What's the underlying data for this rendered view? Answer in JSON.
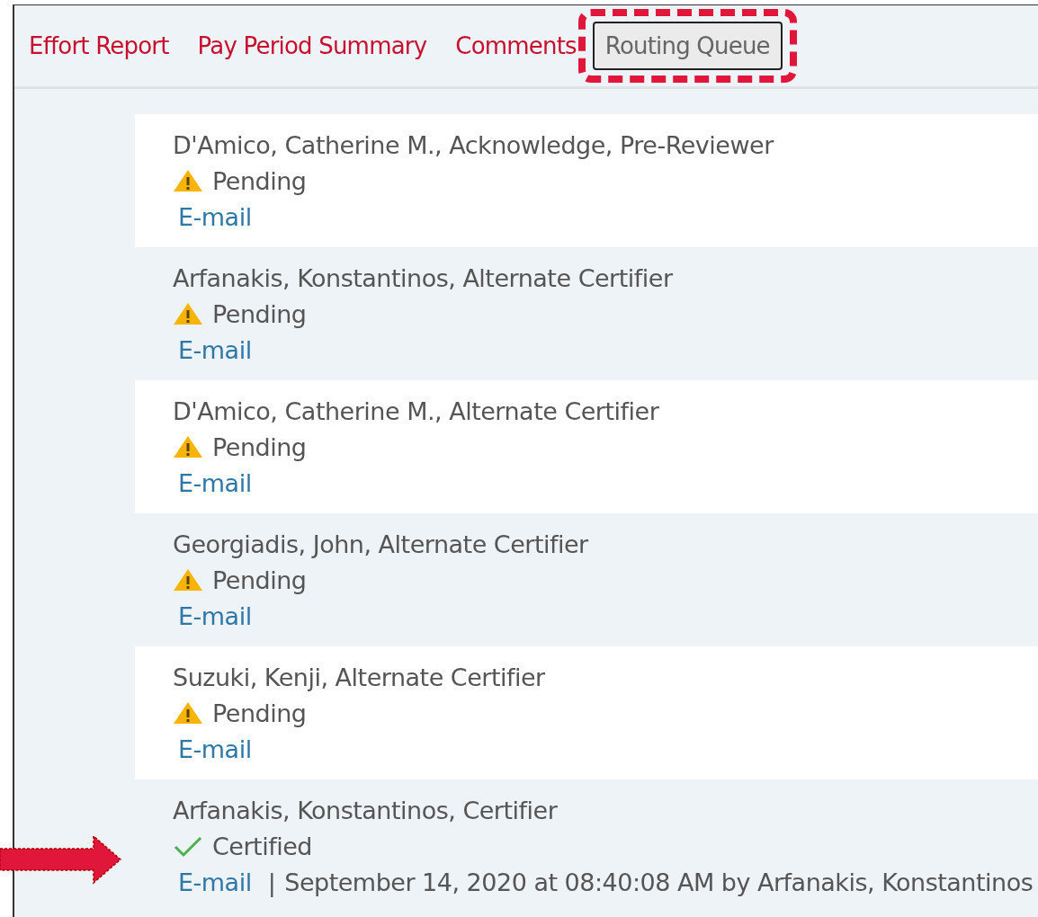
{
  "tabs": [
    {
      "label": "Effort Report",
      "selected": false,
      "highlighted": false
    },
    {
      "label": "Pay Period Summary",
      "selected": false,
      "highlighted": false
    },
    {
      "label": "Comments",
      "selected": false,
      "highlighted": false
    },
    {
      "label": "Routing Queue",
      "selected": true,
      "highlighted": true
    }
  ],
  "queue": [
    {
      "name": "D'Amico, Catherine M., Acknowledge, Pre-Reviewer",
      "kind": "pending",
      "status_text": "Pending",
      "link": "E-mail",
      "marked": false
    },
    {
      "name": "Arfanakis, Konstantinos, Alternate Certifier",
      "kind": "pending",
      "status_text": "Pending",
      "link": "E-mail",
      "marked": false
    },
    {
      "name": "D'Amico, Catherine M., Alternate Certifier",
      "kind": "pending",
      "status_text": "Pending",
      "link": "E-mail",
      "marked": false
    },
    {
      "name": "Georgiadis, John, Alternate Certifier",
      "kind": "pending",
      "status_text": "Pending",
      "link": "E-mail",
      "marked": false
    },
    {
      "name": "Suzuki, Kenji, Alternate Certifier",
      "kind": "pending",
      "status_text": "Pending",
      "link": "E-mail",
      "marked": false
    },
    {
      "name": "Arfanakis, Konstantinos, Certifier",
      "kind": "certified",
      "status_text": "Certified",
      "link": "E-mail",
      "separator": "|",
      "detail": "September 14, 2020 at 08:40:08 AM by Arfanakis, Konstantinos",
      "marked": true
    }
  ]
}
